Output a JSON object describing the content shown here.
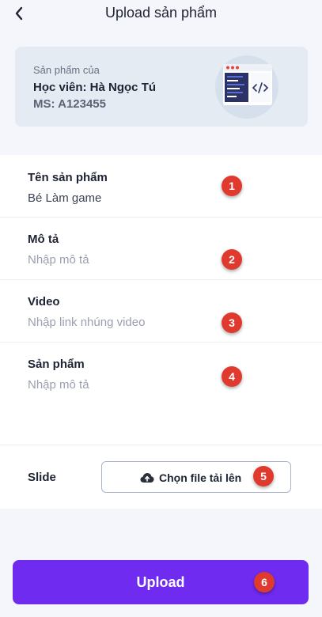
{
  "header": {
    "title": "Upload sản phẩm"
  },
  "info": {
    "label": "Sản phẩm của",
    "student": "Học viên: Hà Ngọc Tú",
    "ms": "MS: A123455"
  },
  "form": {
    "name": {
      "label": "Tên sản phẩm",
      "value": "Bé Làm game",
      "badge": "1"
    },
    "desc": {
      "label": "Mô tả",
      "placeholder": "Nhập mô tả",
      "badge": "2"
    },
    "video": {
      "label": "Video",
      "placeholder": "Nhập link nhúng video",
      "badge": "3"
    },
    "product": {
      "label": "Sản phẩm",
      "placeholder": "Nhập mô tả",
      "badge": "4"
    },
    "slide": {
      "label": "Slide",
      "button": "Chọn file tải lên",
      "badge": "5"
    }
  },
  "upload": {
    "label": "Upload",
    "badge": "6"
  },
  "colors": {
    "accent": "#6f2cf0",
    "badge": "#e03a2f",
    "card": "#e5ebf3"
  },
  "icons": {
    "back": "chevron-left-icon",
    "cloud": "cloud-upload-icon",
    "illustration": "code-window-icon"
  }
}
